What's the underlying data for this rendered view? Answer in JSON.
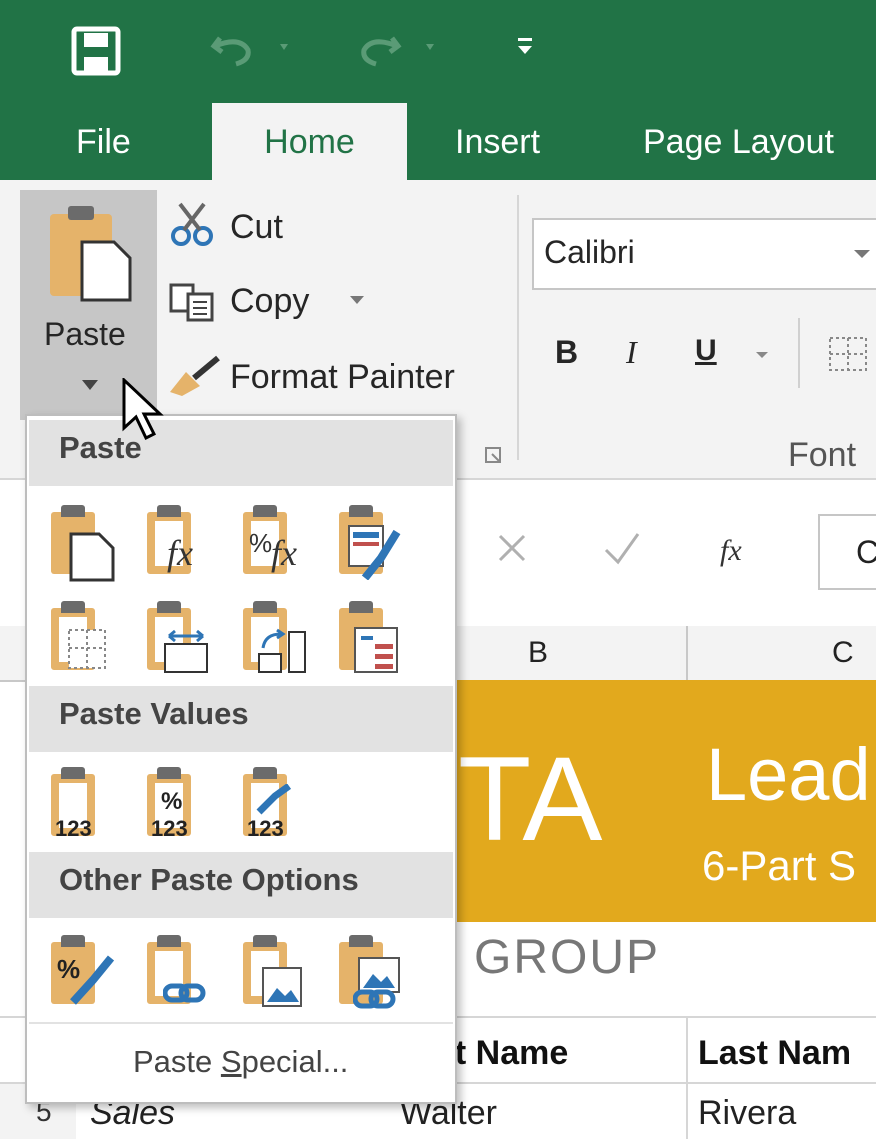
{
  "colors": {
    "accent": "#217346",
    "banner": "#e2a91d",
    "clipboard": "#e5b36a"
  },
  "qat": {
    "icons": [
      "save-icon",
      "undo-icon",
      "redo-icon",
      "customize-icon"
    ]
  },
  "tabs": {
    "file": "File",
    "home": "Home",
    "insert": "Insert",
    "page_layout": "Page Layout"
  },
  "clipboard": {
    "paste": "Paste",
    "cut": "Cut",
    "copy": "Copy",
    "format_painter": "Format Painter"
  },
  "font": {
    "name": "Calibri",
    "bold": "B",
    "italic": "I",
    "underline": "U",
    "group_label": "Font"
  },
  "formula_bar": {
    "fx": "fx",
    "cell_partial": "C"
  },
  "columns": {
    "b": "B",
    "c": "C"
  },
  "sheet": {
    "banner_logo_partial": "TA",
    "banner_title_partial": "Lead",
    "banner_subtitle_partial": "6-Part S",
    "group_text": "GROUP",
    "header_first_partial": "st Name",
    "header_last_partial": "Last Nam",
    "row5": {
      "num": "5",
      "a": "Sales",
      "b": "Walter",
      "c": "Rivera"
    }
  },
  "paste_menu": {
    "section_paste": "Paste",
    "section_values": "Paste Values",
    "section_other": "Other Paste Options",
    "paste_special_pre": "Paste ",
    "paste_special_key": "S",
    "paste_special_post": "pecial...",
    "values_badge": "123",
    "pct_badge": "%"
  }
}
